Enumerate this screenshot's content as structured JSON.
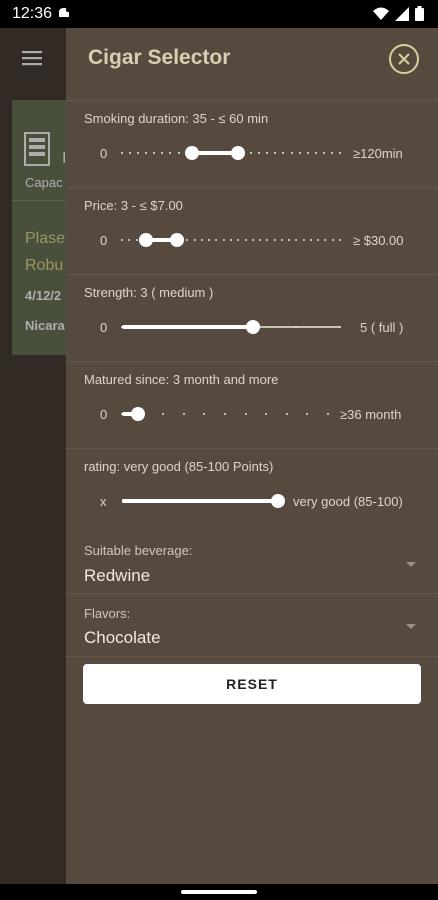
{
  "status_bar": {
    "time": "12:36"
  },
  "background": {
    "card_capacity": "Capac",
    "card_name_line1": "Plase",
    "card_name_line2": "Robu",
    "card_date": "4/12/2",
    "card_origin": "Nicara",
    "card_letter": "I"
  },
  "drawer": {
    "title": "Cigar Selector",
    "filters": [
      {
        "label": "Smoking duration: 35 - ≤ 60 min",
        "min": "0",
        "max": "≥120min",
        "range": [
          0.32,
          0.53
        ],
        "ticks": 27
      },
      {
        "label": "Price: 3 - ≤ $7.00",
        "min": "0",
        "max": "≥ $30.00",
        "range": [
          0.11,
          0.25
        ],
        "ticks": 30
      },
      {
        "label": "Strength: 3 ( medium )",
        "min": "0",
        "max": "5 ( full )",
        "value": 0.6,
        "ticks": 5
      },
      {
        "label": "Matured since: 3 month and more",
        "min": "0",
        "max": "≥36 month",
        "value": 0.08,
        "ticks": 10
      },
      {
        "label": "rating: very good (85-100 Points)",
        "min": "x",
        "max": "very good (85-100)",
        "value": 1.0,
        "ticks": 0
      }
    ],
    "beverage": {
      "label": "Suitable beverage:",
      "value": "Redwine"
    },
    "flavors": {
      "label": "Flavors:",
      "value": "Chocolate"
    },
    "reset_label": "RESET"
  },
  "colors": {
    "drawer_bg": "#564a3e",
    "accent": "#d8cf9a",
    "card_bg": "#6b7758",
    "track_active": "#ffffff",
    "track_inactive": "#c9c1b4"
  },
  "icons": [
    "menu-icon",
    "close-icon",
    "wifi-icon",
    "signal-icon",
    "battery-icon",
    "dropdown-arrow-icon"
  ]
}
